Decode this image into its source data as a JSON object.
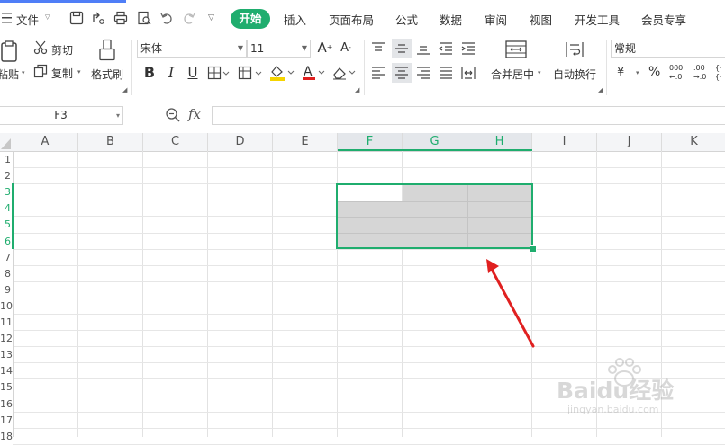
{
  "menu": {
    "file": "文件",
    "tabs": [
      "开始",
      "插入",
      "页面布局",
      "公式",
      "数据",
      "审阅",
      "视图",
      "开发工具",
      "会员专享"
    ]
  },
  "ribbon": {
    "paste": "粘贴",
    "cut": "剪切",
    "copy": "复制",
    "format_painter": "格式刷",
    "font_name": "宋体",
    "font_size": "11",
    "bold": "B",
    "italic": "I",
    "underline": "U",
    "merge_center": "合并居中",
    "wrap_text": "自动换行",
    "number_format": "常规",
    "currency": "¥",
    "percent": "%",
    "dec_inc": "000",
    "dec_inc2": "←.0",
    "dec_dec": ".00",
    "dec_dec2": "→.0"
  },
  "formula": {
    "name_box": "F3",
    "fx": "fx"
  },
  "grid": {
    "columns": [
      "A",
      "B",
      "C",
      "D",
      "E",
      "F",
      "G",
      "H",
      "I",
      "J",
      "K"
    ],
    "selected_columns": [
      "F",
      "G",
      "H"
    ],
    "rows": [
      "1",
      "2",
      "3",
      "4",
      "5",
      "6",
      "7",
      "8",
      "9",
      "10",
      "11",
      "12",
      "13",
      "14",
      "15",
      "16",
      "17",
      "18"
    ]
  },
  "colors": {
    "accent": "#1fad6e",
    "selection_fill": "#d6d6d6",
    "arrow": "#e02020"
  },
  "watermark": {
    "brand": "Baidu经验",
    "url": "jingyan.baidu.com"
  }
}
